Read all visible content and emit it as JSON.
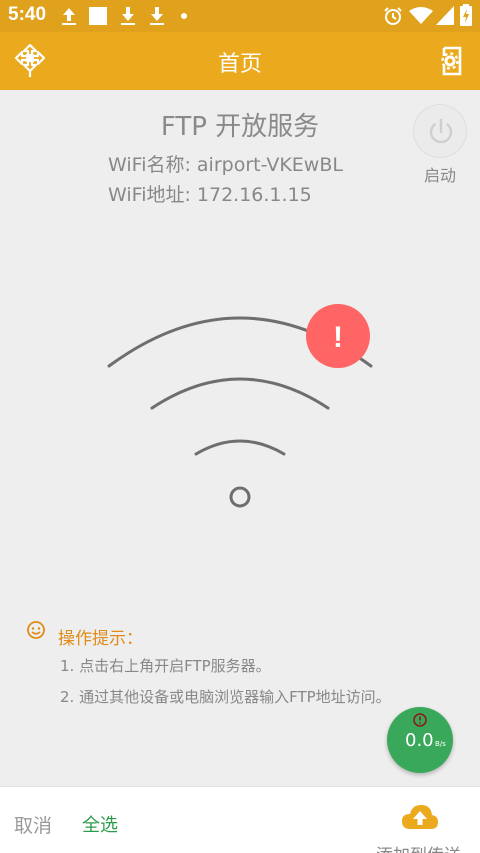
{
  "status_bar": {
    "time": "5:40",
    "left_icons": [
      "upload-icon",
      "square-icon",
      "download-icon",
      "download-icon",
      "dot-icon"
    ],
    "right_icons": [
      "alarm-icon",
      "wifi-icon",
      "signal-icon",
      "battery-charging-icon"
    ]
  },
  "app_bar": {
    "title": "首页",
    "left_icon": "app-logo-icon",
    "right_icon": "settings-phone-icon",
    "color": "#eba91d"
  },
  "server": {
    "title": "FTP 开放服务",
    "wifi_name_line": "WiFi名称: airport-VKEwBL",
    "wifi_address_line": "WiFi地址: 172.16.1.15",
    "start_label": "启动",
    "status_icon": "error-exclamation-icon",
    "status_mark": "!",
    "status_color": "#ff6565"
  },
  "tips": {
    "title": "操作提示：",
    "items": [
      "1. 点击右上角开启FTP服务器。",
      "2. 通过其他设备或电脑浏览器输入FTP地址访问。"
    ]
  },
  "speed": {
    "value": "0.0",
    "unit": "B/s",
    "color": "#3aa85a"
  },
  "bottom_bar": {
    "cancel_label": "取消",
    "select_all_label": "全选",
    "add_transfer_label": "添加到传送",
    "accent": "#2c9b4a"
  }
}
